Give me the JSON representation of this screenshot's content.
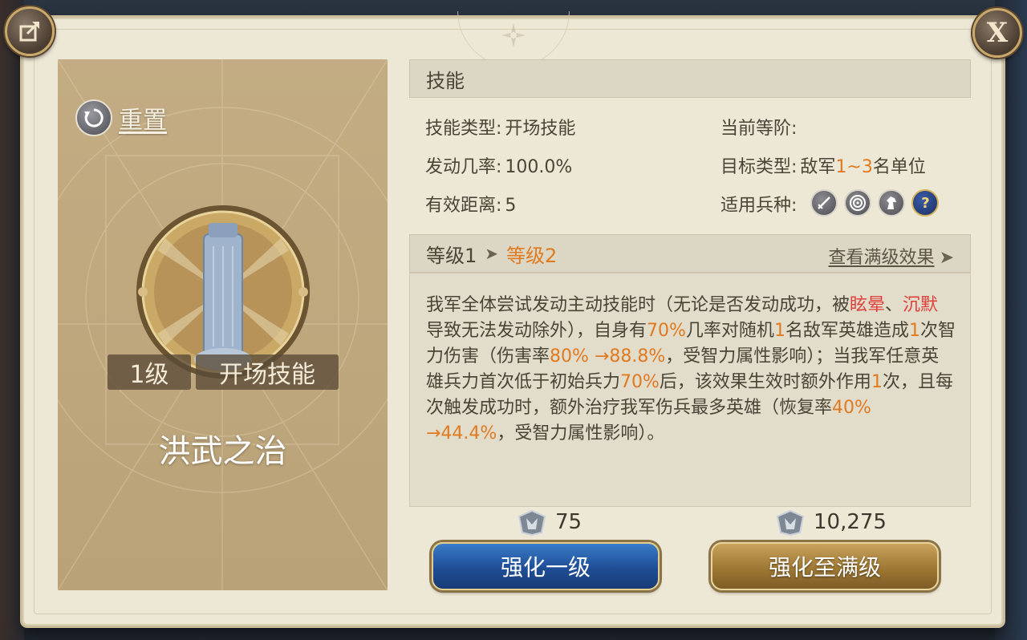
{
  "dialog": {
    "close_label": "X"
  },
  "left": {
    "reset_label": "重置",
    "level_tag": "1级",
    "type_tag": "开场技能",
    "skill_name": "洪武之治"
  },
  "skill_section": {
    "title": "技能",
    "stats": {
      "type_label": "技能类型:",
      "type_value": "开场技能",
      "tier_label": "当前等阶:",
      "tier_value": "",
      "chance_label": "发动几率:",
      "chance_value": "100.0%",
      "target_label": "目标类型:",
      "target_prefix": "敌军",
      "target_range": "1~3",
      "target_suffix": "名单位",
      "distance_label": "有效距离:",
      "distance_value": "5",
      "units_label": "适用兵种:",
      "unit_icons": [
        "sword-icon",
        "target-icon",
        "horse-icon",
        "question-icon"
      ]
    }
  },
  "level_section": {
    "current": "等级1",
    "next": "等级2",
    "view_max": "查看满级效果"
  },
  "description": {
    "p1": "我军全体尝试发动主动技能时（无论是否发动成功，被",
    "dizzy": "眩晕",
    "p2": "、",
    "silence": "沉默",
    "p3": "导致无法发动除外），自身有",
    "chance": "70%",
    "p4": "几率对随机",
    "count1": "1",
    "p5": "名敌军英雄造成",
    "count2": "1",
    "p6": "次智力伤害（伤害率",
    "dmg_rate": "80% →88.8%",
    "p7": "，受智力属性影响）；当我军任意英雄兵力首次低于初始兵力",
    "threshold": "70%",
    "p8": "后，该效果生效时额外作用",
    "count3": "1",
    "p9": "次，且每次触发成功时，额外治疗我军伤兵最多英雄（恢复率",
    "heal_rate": "40% →44.4%",
    "p10": "，受智力属性影响）。"
  },
  "costs": {
    "one_level": "75",
    "max_level": "10,275"
  },
  "buttons": {
    "upgrade_one": "强化一级",
    "upgrade_max": "强化至满级"
  },
  "colors": {
    "highlight": "#e07a20",
    "status_red": "#e0403a",
    "panel_gold": "#c3ac83",
    "button_blue": "#1f4e96",
    "button_gold": "#9e7834"
  }
}
